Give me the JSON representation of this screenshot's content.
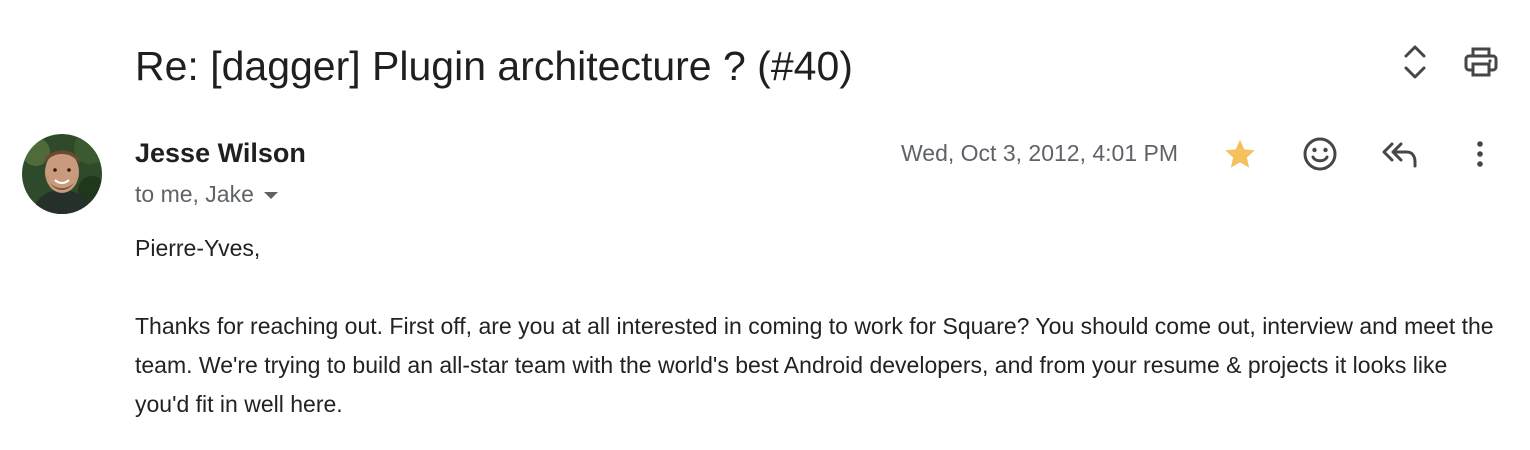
{
  "thread": {
    "subject": "Re: [dagger] Plugin architecture ? (#40)"
  },
  "icons": {
    "expand": "unfold-icon",
    "print": "print-icon",
    "star": "star-icon",
    "emoji": "emoji-icon",
    "reply_all": "reply-all-icon",
    "more": "more-vert-icon",
    "avatar": "avatar"
  },
  "colors": {
    "star": "#f4c15d",
    "icon": "#444746",
    "secondary_text": "#5f6368"
  },
  "message": {
    "sender_name": "Jesse Wilson",
    "recipients": "to me, Jake",
    "date": "Wed, Oct 3, 2012, 4:01 PM",
    "body": [
      "Pierre-Yves,",
      "Thanks for reaching out. First off, are you at all interested in coming to work for Square? You should come out, interview and meet the team. We're trying to build an all-star team with the world's best Android developers, and from your resume & projects it looks like you'd fit in well here."
    ]
  }
}
